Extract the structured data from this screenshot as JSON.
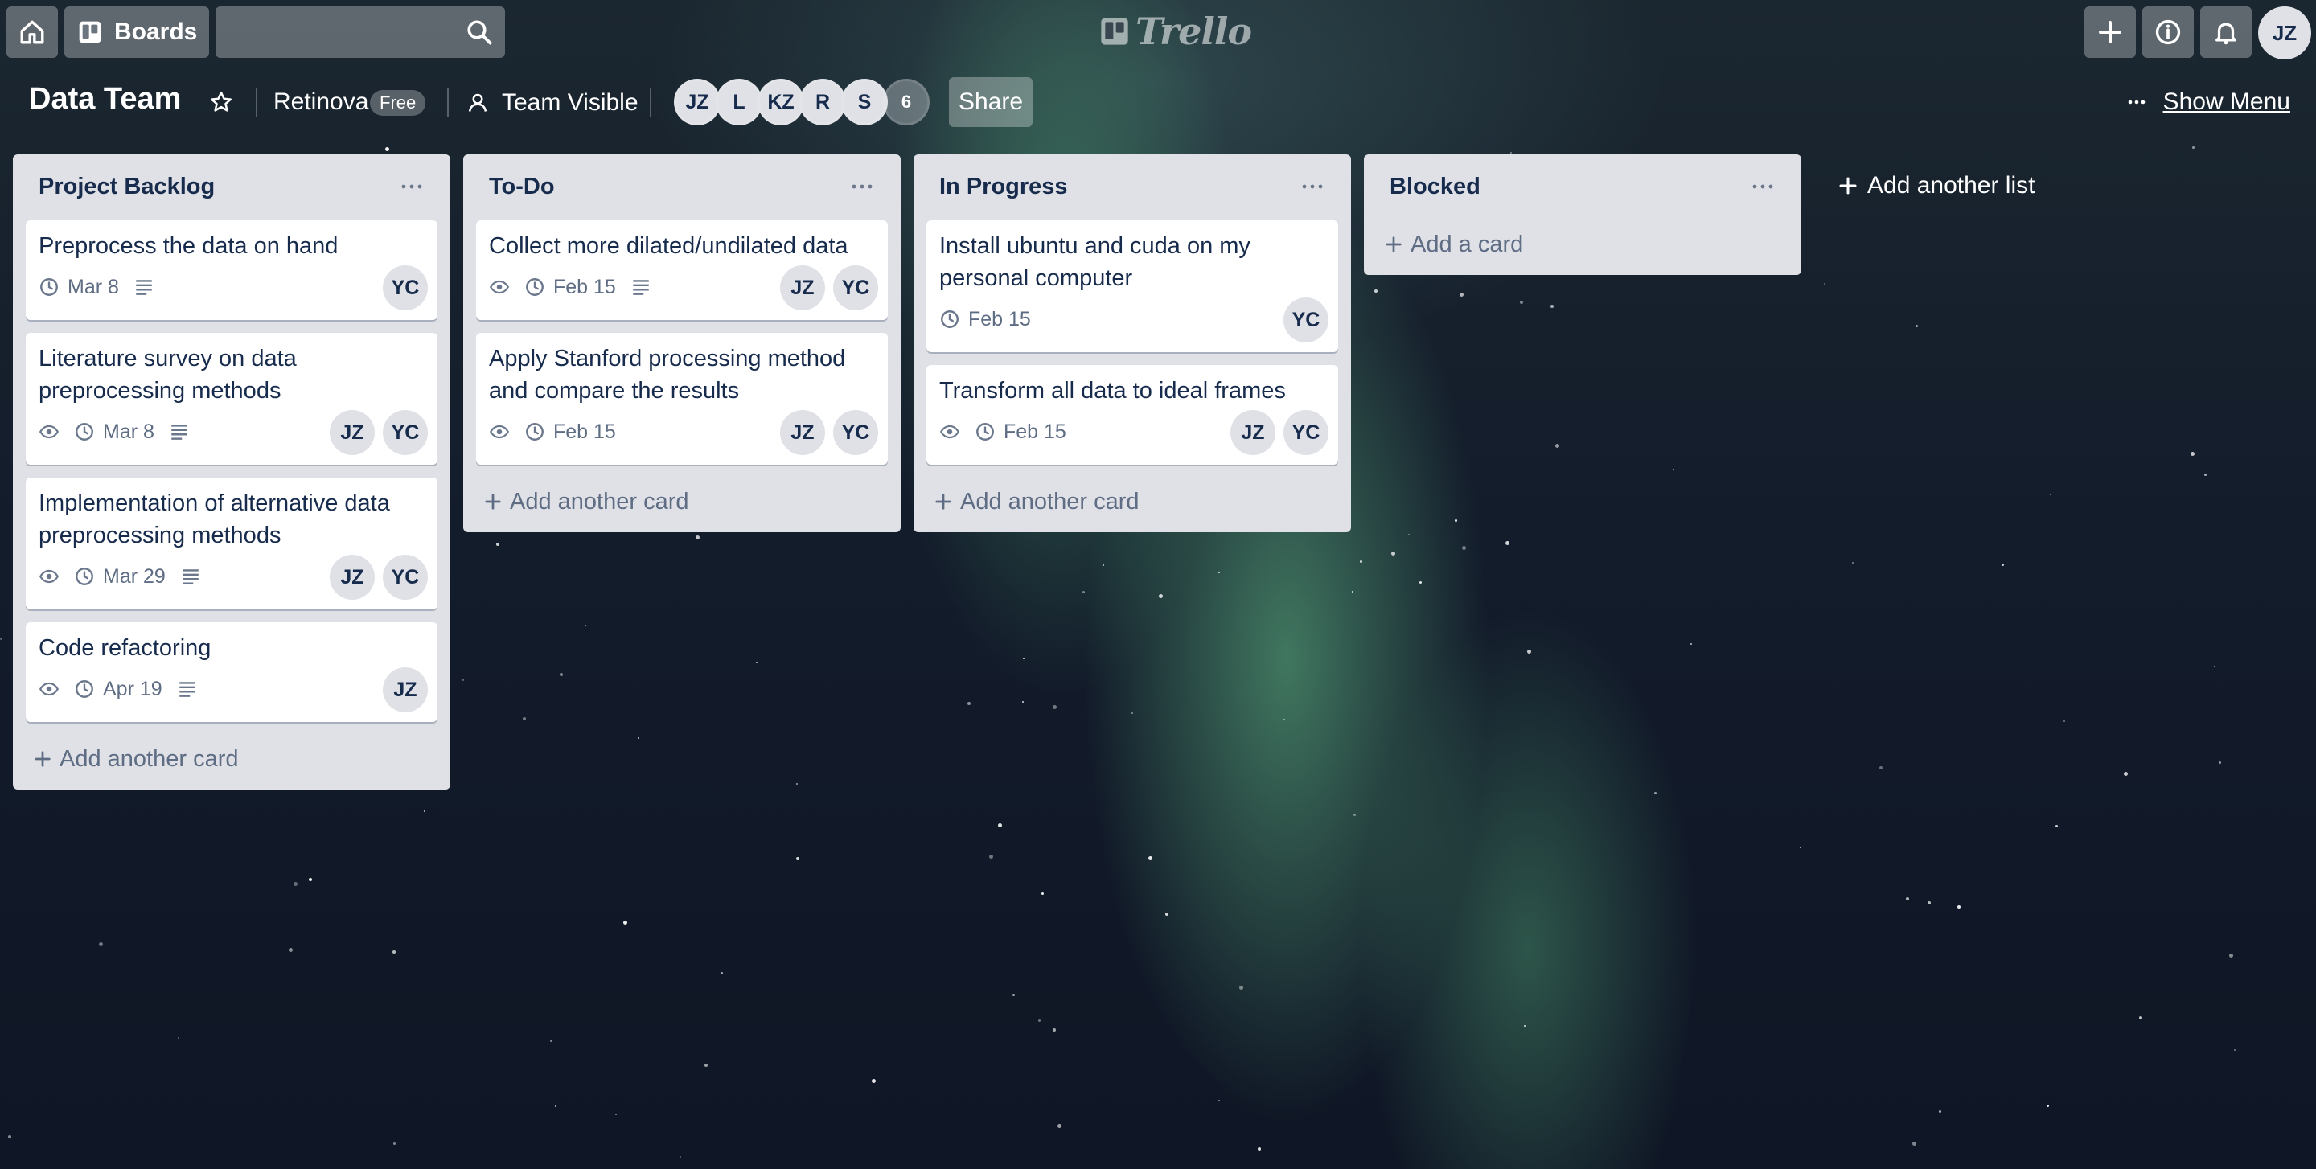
{
  "header": {
    "boards_label": "Boards",
    "search_value": "",
    "logo_text": "Trello",
    "user_initials": "JZ"
  },
  "board": {
    "title": "Data Team",
    "team_name": "Retinova",
    "plan_badge": "Free",
    "visibility": "Team Visible",
    "members": [
      "JZ",
      "L",
      "KZ",
      "R",
      "S"
    ],
    "more_members_count": "6",
    "share_label": "Share",
    "show_menu_label": "Show Menu"
  },
  "lists": [
    {
      "title": "Project Backlog",
      "add_label": "Add another card",
      "cards": [
        {
          "title": "Preprocess the data on hand",
          "watch": false,
          "due": "Mar 8",
          "description": true,
          "members": [
            "YC"
          ]
        },
        {
          "title": "Literature survey on data preprocessing methods",
          "watch": true,
          "due": "Mar 8",
          "description": true,
          "members": [
            "JZ",
            "YC"
          ]
        },
        {
          "title": "Implementation of alternative data preprocessing methods",
          "watch": true,
          "due": "Mar 29",
          "description": true,
          "members": [
            "JZ",
            "YC"
          ]
        },
        {
          "title": "Code refactoring",
          "watch": true,
          "due": "Apr 19",
          "description": true,
          "members": [
            "JZ"
          ]
        }
      ]
    },
    {
      "title": "To-Do",
      "add_label": "Add another card",
      "cards": [
        {
          "title": "Collect more dilated/undilated data",
          "watch": true,
          "due": "Feb 15",
          "description": true,
          "members": [
            "JZ",
            "YC"
          ]
        },
        {
          "title": "Apply Stanford processing method and compare the results",
          "watch": true,
          "due": "Feb 15",
          "description": false,
          "members": [
            "JZ",
            "YC"
          ]
        }
      ]
    },
    {
      "title": "In Progress",
      "add_label": "Add another card",
      "cards": [
        {
          "title": "Install ubuntu and cuda on my personal computer",
          "watch": false,
          "due": "Feb 15",
          "description": false,
          "members": [
            "YC"
          ]
        },
        {
          "title": "Transform all data to ideal frames",
          "watch": true,
          "due": "Feb 15",
          "description": false,
          "members": [
            "JZ",
            "YC"
          ]
        }
      ]
    },
    {
      "title": "Blocked",
      "add_label": "Add a card",
      "cards": []
    }
  ],
  "add_list_label": "Add another list",
  "colors": {
    "list_bg": "#dfe1e6",
    "card_bg": "#ffffff",
    "text": "#172b4d",
    "muted": "#5e6c84"
  }
}
